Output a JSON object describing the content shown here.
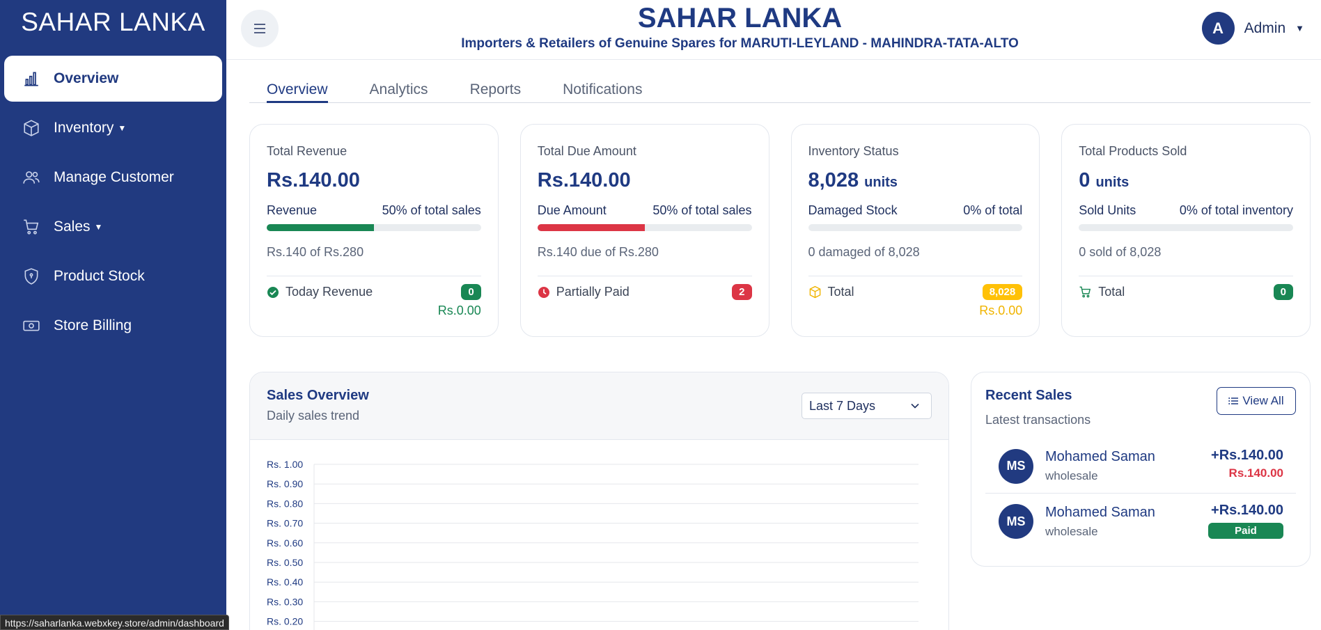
{
  "brand": "SAHAR LANKA",
  "sidebar": {
    "items": [
      {
        "label": "Overview",
        "icon": "bar-chart-icon"
      },
      {
        "label": "Inventory",
        "icon": "box-icon",
        "caret": true
      },
      {
        "label": "Manage Customer",
        "icon": "people-icon"
      },
      {
        "label": "Sales",
        "icon": "cart-icon",
        "caret": true
      },
      {
        "label": "Product Stock",
        "icon": "shield-icon"
      },
      {
        "label": "Store Billing",
        "icon": "cash-icon"
      }
    ]
  },
  "header": {
    "title": "SAHAR LANKA",
    "subtitle": "Importers & Retailers of Genuine Spares for MARUTI-LEYLAND - MAHINDRA-TATA-ALTO",
    "user_initial": "A",
    "user_name": "Admin"
  },
  "tabs": [
    "Overview",
    "Analytics",
    "Reports",
    "Notifications"
  ],
  "cards": [
    {
      "title": "Total Revenue",
      "value": "Rs.140.00",
      "unit": "",
      "row_left": "Revenue",
      "row_right": "50% of total sales",
      "progress": 0.5,
      "bar_color": "#198754",
      "note": "Rs.140 of Rs.280",
      "foot_label": "Today Revenue",
      "foot_icon": "check-circle-icon",
      "badge": "0",
      "badge_color": "#198754",
      "foot_sub": "Rs.0.00",
      "foot_sub_color": "#198754"
    },
    {
      "title": "Total Due Amount",
      "value": "Rs.140.00",
      "unit": "",
      "row_left": "Due Amount",
      "row_right": "50% of total sales",
      "progress": 0.5,
      "bar_color": "#dc3545",
      "note": "Rs.140 due of Rs.280",
      "foot_label": "Partially Paid",
      "foot_icon": "clock-icon",
      "badge": "2",
      "badge_color": "#dc3545",
      "foot_sub": "",
      "foot_sub_color": ""
    },
    {
      "title": "Inventory Status",
      "value": "8,028",
      "unit": "units",
      "row_left": "Damaged Stock",
      "row_right": "0% of total",
      "progress": 0,
      "bar_color": "#f0b400",
      "note": "0 damaged of 8,028",
      "foot_label": "Total",
      "foot_icon": "box-icon",
      "badge": "8,028",
      "badge_color": "#ffc107",
      "foot_sub": "Rs.0.00",
      "foot_sub_color": "#f0b400"
    },
    {
      "title": "Total Products Sold",
      "value": "0",
      "unit": "units",
      "row_left": "Sold Units",
      "row_right": "0% of total inventory",
      "progress": 0,
      "bar_color": "#198754",
      "note": "0 sold of 8,028",
      "foot_label": "Total",
      "foot_icon": "cart-icon",
      "badge": "0",
      "badge_color": "#198754",
      "foot_sub": "",
      "foot_sub_color": ""
    }
  ],
  "sales_overview": {
    "title": "Sales Overview",
    "subtitle": "Daily sales trend",
    "range_selected": "Last 7 Days"
  },
  "chart_data": {
    "type": "line",
    "title": "",
    "xlabel": "",
    "ylabel": "",
    "ylim": [
      0,
      1.0
    ],
    "y_ticks": [
      "Rs. 1.00",
      "Rs. 0.90",
      "Rs. 0.80",
      "Rs. 0.70",
      "Rs. 0.60",
      "Rs. 0.50",
      "Rs. 0.40",
      "Rs. 0.30",
      "Rs. 0.20"
    ],
    "series": [],
    "grid": true
  },
  "recent_sales": {
    "title": "Recent Sales",
    "subtitle": "Latest transactions",
    "view_all": "View All",
    "items": [
      {
        "initials": "MS",
        "name": "Mohamed Saman",
        "type": "wholesale",
        "amount": "+Rs.140.00",
        "due": "Rs.140.00",
        "status": ""
      },
      {
        "initials": "MS",
        "name": "Mohamed Saman",
        "type": "wholesale",
        "amount": "+Rs.140.00",
        "due": "",
        "status": "Paid"
      }
    ]
  },
  "statusbar_url": "https://saharlanka.webxkey.store/admin/dashboard"
}
